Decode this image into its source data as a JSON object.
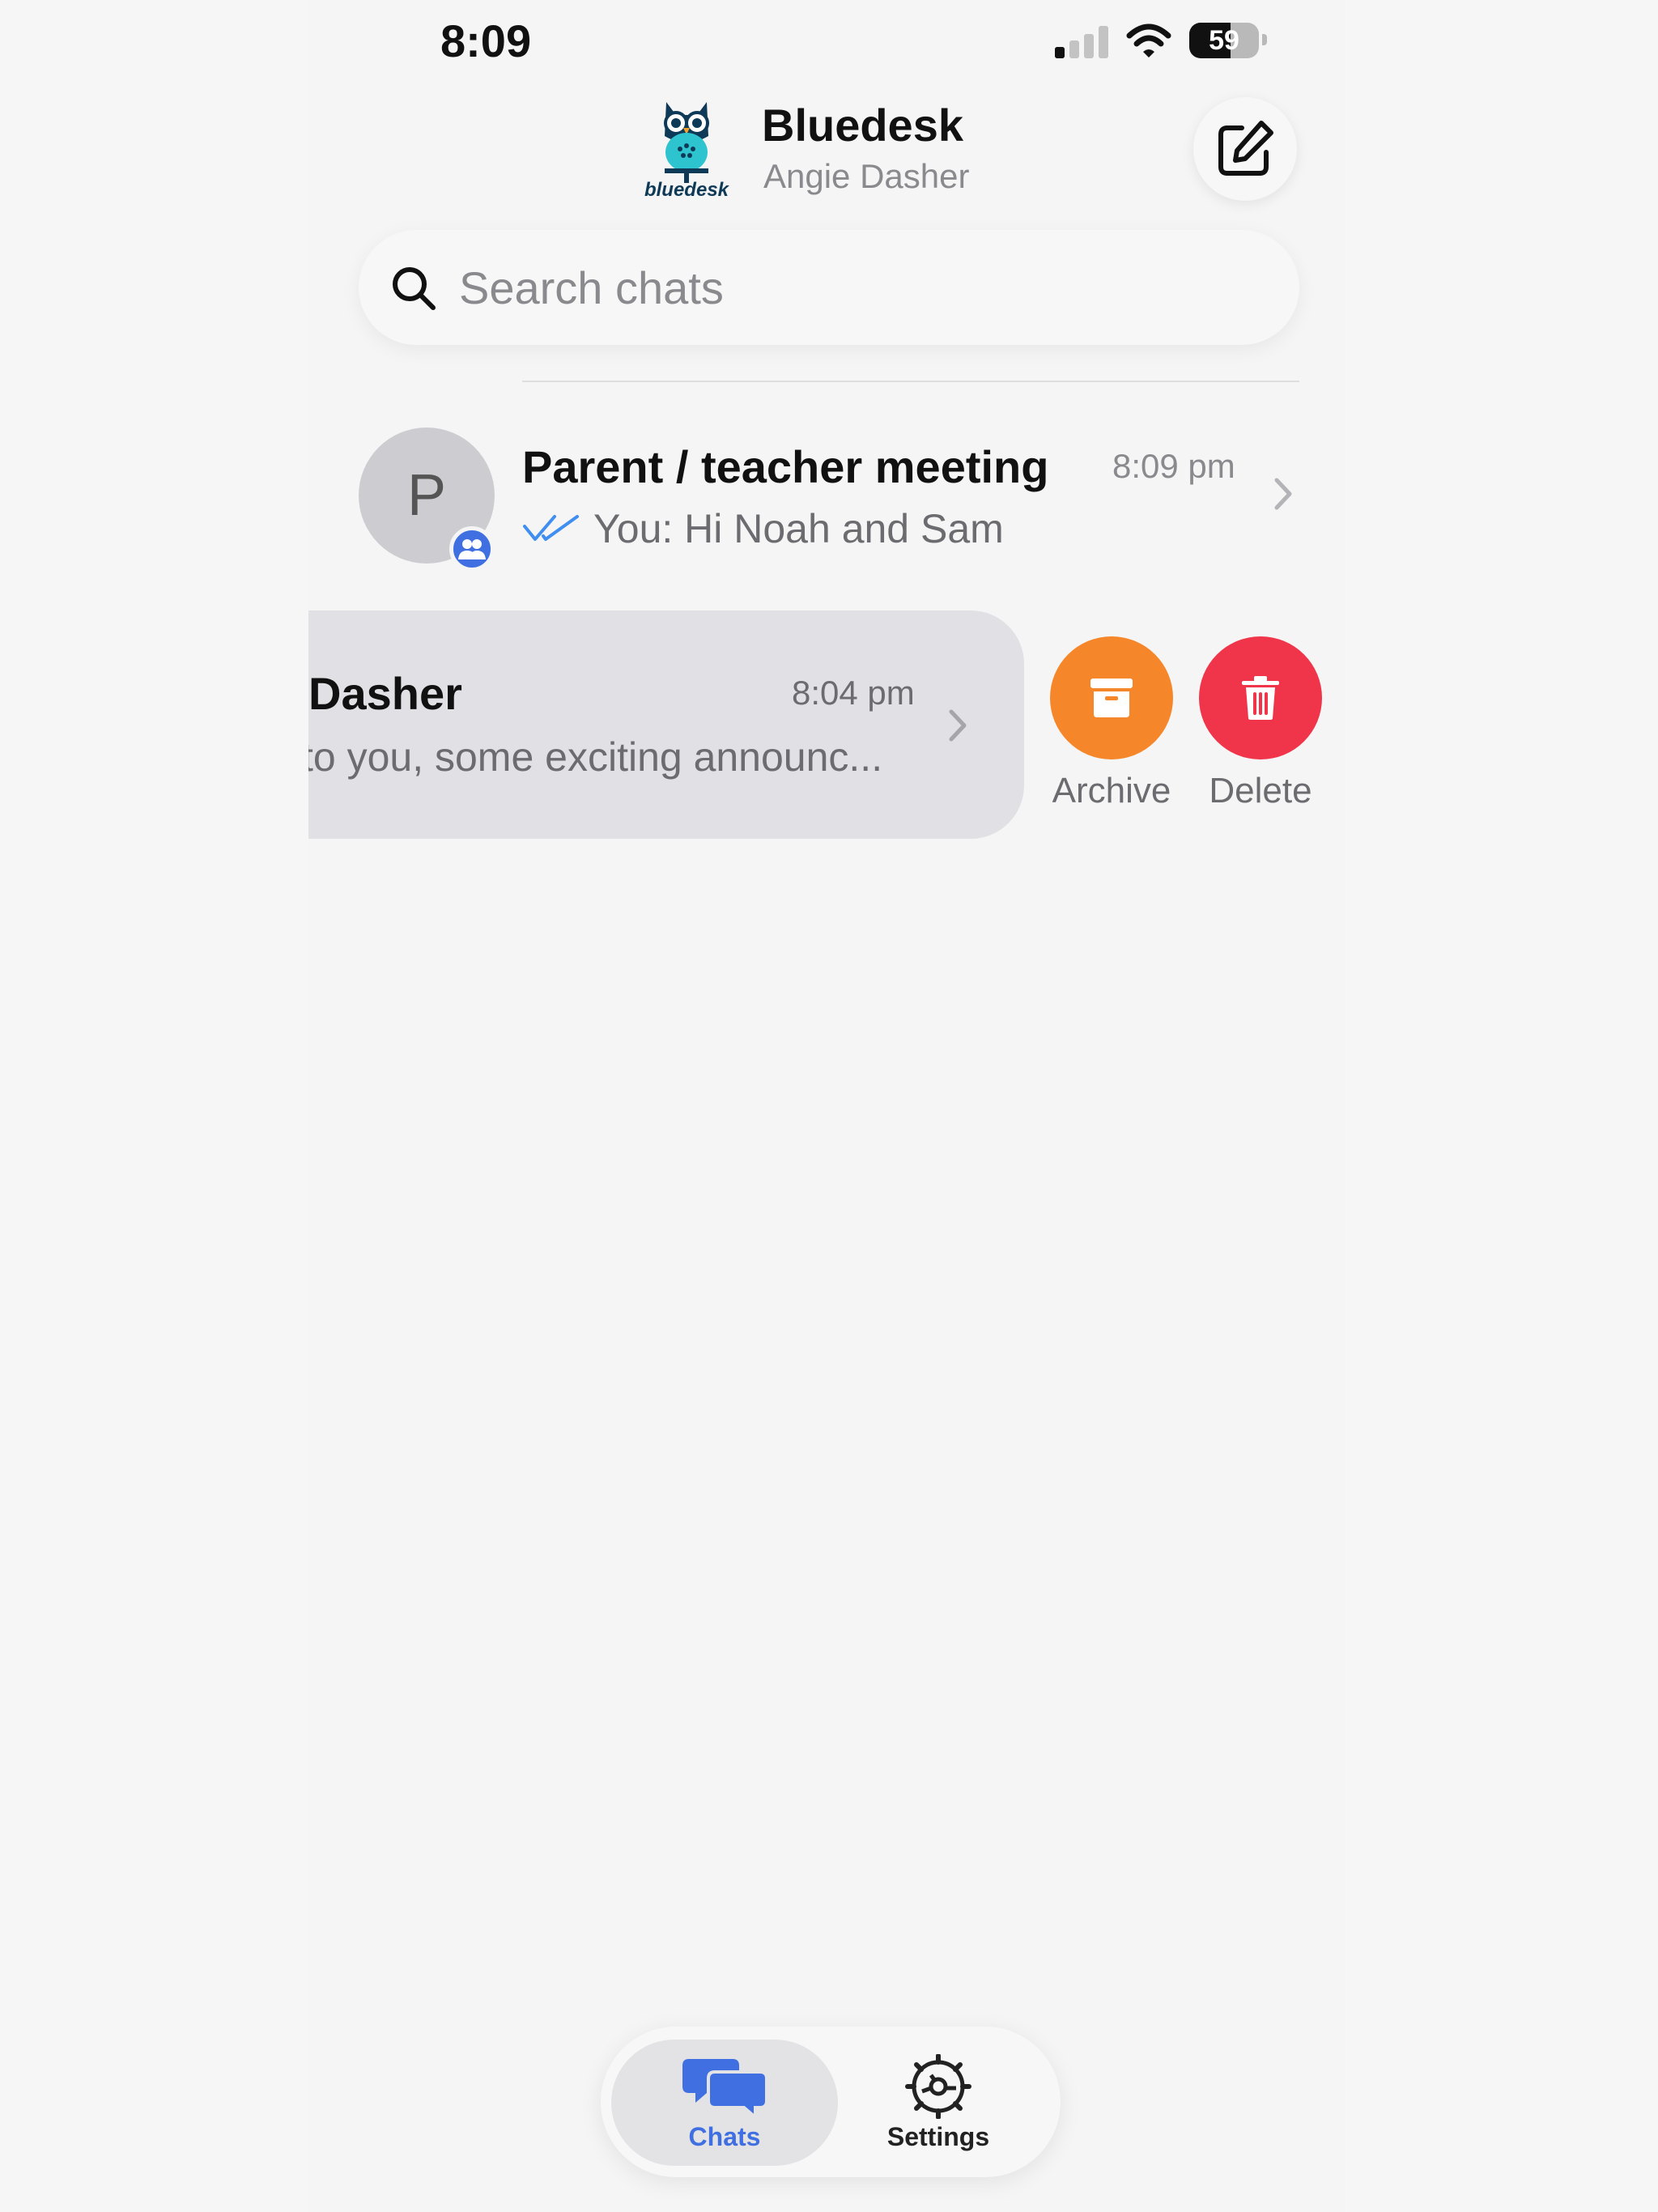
{
  "status_bar": {
    "time": "8:09",
    "battery_level": "59",
    "battery_fraction": 0.59
  },
  "header": {
    "app_name": "Bluedesk",
    "user_name": "Angie Dasher",
    "logo_text": "bluedesk",
    "compose_icon": "compose-icon"
  },
  "search": {
    "placeholder": "Search chats",
    "value": ""
  },
  "chats": [
    {
      "name": "Parent / teacher meeting",
      "time": "8:09 pm",
      "avatar_letter": "P",
      "preview": "You: Hi Noah and Sam",
      "is_group": true,
      "read_status": "read"
    },
    {
      "name": "Dasher",
      "time": "8:04 pm",
      "preview": "to you, some exciting announc..."
    }
  ],
  "swipe_actions": {
    "archive_label": "Archive",
    "delete_label": "Delete"
  },
  "tab_bar": {
    "tabs": [
      {
        "label": "Chats",
        "icon": "chat-bubbles-icon",
        "active": true
      },
      {
        "label": "Settings",
        "icon": "gear-icon",
        "active": false
      }
    ]
  },
  "colors": {
    "accent": "#3f6fe0",
    "archive": "#f5872a",
    "delete": "#f0354a",
    "background": "#f5f5f5"
  }
}
